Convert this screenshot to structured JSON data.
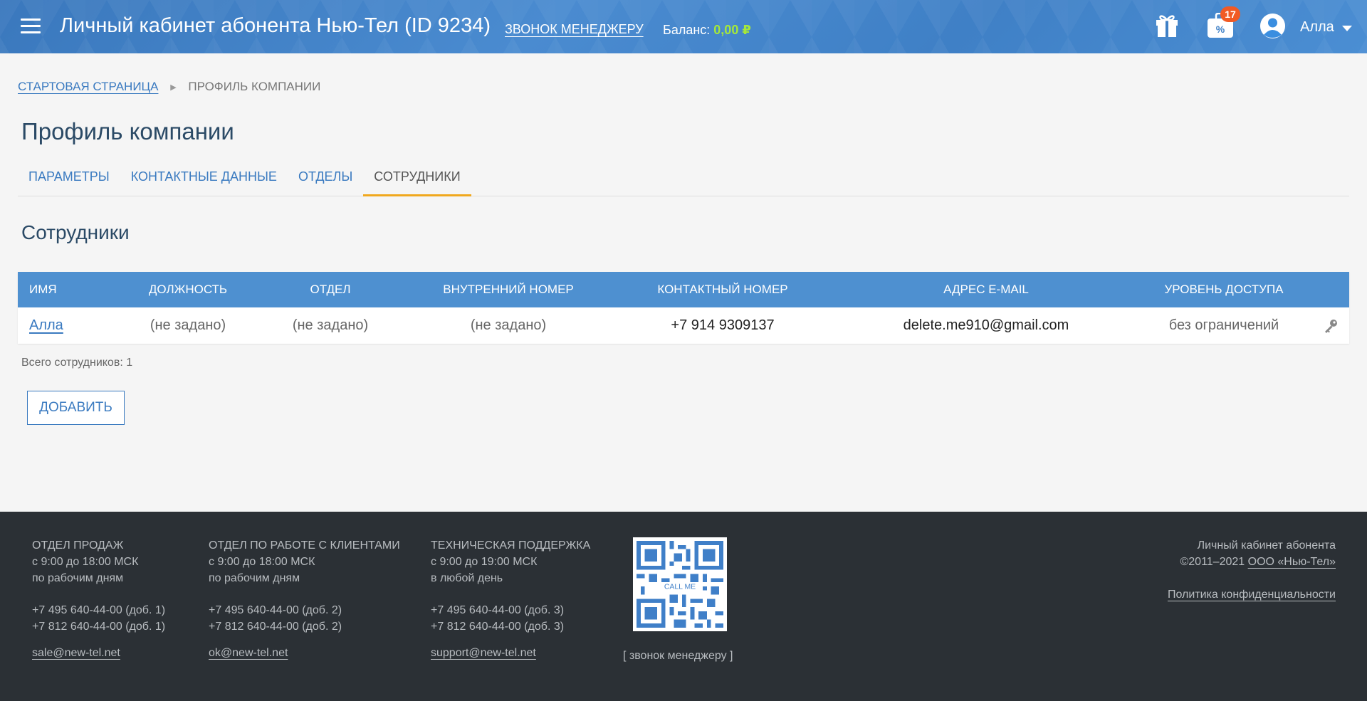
{
  "header": {
    "title": "Личный кабинет абонента Нью-Тел (ID 9234)",
    "call_manager": "ЗВОНОК МЕНЕДЖЕРУ",
    "balance_label": "Баланс:",
    "balance_value": "0,00 ₽",
    "promo_badge": "17",
    "user_name": "Алла",
    "icons": [
      "menu-icon",
      "gift-icon",
      "percent-bag-icon",
      "user-avatar-icon",
      "caret-down-icon"
    ]
  },
  "breadcrumb": {
    "home": "СТАРТОВАЯ СТРАНИЦА",
    "current": "ПРОФИЛЬ КОМПАНИИ"
  },
  "page_title": "Профиль компании",
  "tabs": [
    {
      "label": "ПАРАМЕТРЫ",
      "active": false
    },
    {
      "label": "КОНТАКТНЫЕ ДАННЫЕ",
      "active": false
    },
    {
      "label": "ОТДЕЛЫ",
      "active": false
    },
    {
      "label": "СОТРУДНИКИ",
      "active": true
    }
  ],
  "section_title": "Сотрудники",
  "table": {
    "headers": [
      "ИМЯ",
      "ДОЛЖНОСТЬ",
      "ОТДЕЛ",
      "ВНУТРЕННИЙ НОМЕР",
      "КОНТАКТНЫЙ НОМЕР",
      "АДРЕС E-MAIL",
      "УРОВЕНЬ ДОСТУПА"
    ],
    "rows": [
      {
        "name": "Алла",
        "position": "(не задано)",
        "department": "(не задано)",
        "internal": "(не задано)",
        "phone": "+7 914 9309137",
        "email": "delete.me910@gmail.com",
        "access": "без ограничений"
      }
    ]
  },
  "total": "Всего сотрудников: 1",
  "add_button": "ДОБАВИТЬ",
  "footer": {
    "sales": {
      "title": "ОТДЕЛ ПРОДАЖ",
      "hours": "с 9:00 до 18:00 МСК",
      "days": "по рабочим дням",
      "phone1": "+7 495 640-44-00  (доб. 1)",
      "phone2": "+7 812 640-44-00  (доб. 1)",
      "email": "sale@new-tel.net"
    },
    "clients": {
      "title": "ОТДЕЛ ПО РАБОТЕ С КЛИЕНТАМИ",
      "hours": "с 9:00 до 18:00 МСК",
      "days": "по рабочим дням",
      "phone1": "+7 495 640-44-00  (доб. 2)",
      "phone2": "+7 812 640-44-00  (доб. 2)",
      "email": "ok@new-tel.net"
    },
    "support": {
      "title": "ТЕХНИЧЕСКАЯ ПОДДЕРЖКА",
      "hours": "с 9:00 до 19:00 МСК",
      "days": "в любой день",
      "phone1": "+7 495 640-44-00  (доб. 3)",
      "phone2": "+7 812 640-44-00  (доб. 3)",
      "email": "support@new-tel.net"
    },
    "qr_text": "CALL ME",
    "qr_link": "[ звонок менеджеру ]",
    "right_line1": "Личный кабинет абонента",
    "right_copy": "©2011–2021",
    "right_company": "ООО «Нью-Тел»",
    "privacy": "Политика конфиденциальности"
  },
  "colors": {
    "header_bg": "#4282c8",
    "accent": "#3a7ac0",
    "balance": "#a5e83a",
    "tab_active_underline": "#f0a81e",
    "table_header": "#4e90d0",
    "badge": "#f15a24",
    "footer_bg": "#2b3035"
  }
}
